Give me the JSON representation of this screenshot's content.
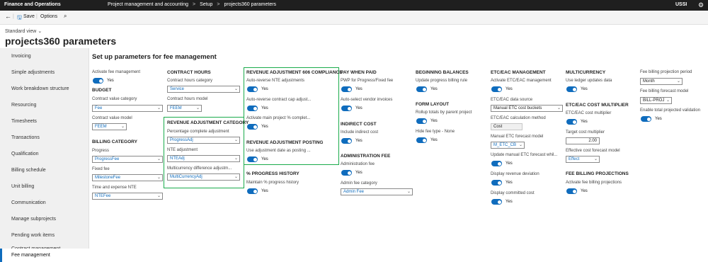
{
  "topbar": {
    "app_name": "Finance and Operations",
    "breadcrumb": [
      "Project management and accounting",
      "Setup",
      "projects360 parameters"
    ],
    "company": "USSI"
  },
  "actionbar": {
    "save_label": "Save",
    "options_label": "Options"
  },
  "header": {
    "view_name": "Standard view",
    "page_title": "projects360 parameters"
  },
  "sidebar": {
    "items": [
      "Invoicing",
      "Simple adjustments",
      "Work breakdown structure",
      "Resourcing",
      "Timesheets",
      "Transactions",
      "Qualification",
      "Billing schedule",
      "Unit billing",
      "Communication",
      "Manage subprojects",
      "Pending work items",
      "Contract management",
      "Fee management"
    ],
    "selected": "Fee management"
  },
  "content": {
    "section_title": "Set up parameters for fee management",
    "yes": "Yes",
    "col1": {
      "activate_label": "Activate fee management",
      "budget_header": "BUDGET",
      "cv_category_label": "Contract value category",
      "cv_category_value": "Fee",
      "cv_model_label": "Contract value model",
      "cv_model_value": "FEEM",
      "billing_header": "BILLING CATEGORY",
      "progress_label": "Progress",
      "progress_value": "ProgressFee",
      "fixed_label": "Fixed fee",
      "fixed_value": "MilestoneFee",
      "te_label": "Time and expense NTE",
      "te_value": "NTEFee"
    },
    "col2": {
      "hours_header": "CONTRACT HOURS",
      "hours_cat_label": "Contract hours category",
      "hours_cat_value": "Service",
      "hours_model_label": "Contract hours model",
      "hours_model_value": "FEEM",
      "rev_cat_header": "REVENUE ADJUSTMENT CATEGORY",
      "pct_label": "Percentage complete adjustment",
      "pct_value": "ProgressAdj",
      "nte_label": "NTE adjustment",
      "nte_value": "NTEAdj",
      "multi_label": "Multicurrency difference adjustm...",
      "multi_value": "MultiCurrencyAdj"
    },
    "col3": {
      "rev606_header": "REVENUE ADJUSTMENT 606 COMPLIANCE",
      "auto_nte_label": "Auto-reverse NTE adjustments",
      "auto_cap_label": "Auto-reverse contract cap adjust...",
      "main_pct_label": "Activate main project % complet...",
      "posting_header": "REVENUE ADJUSTMENT POSTING",
      "use_date_label": "Use adjustment date as posting ...",
      "history_header": "% PROGRESS HISTORY",
      "maintain_label": "Maintain % progress history"
    },
    "col4": {
      "pay_header": "PAY WHEN PAID",
      "pwp_label": "PWP for Progress/Fixed fee",
      "auto_vendor_label": "Auto-select vendor invoices",
      "indirect_header": "INDIRECT COST",
      "include_label": "Include indirect cost",
      "admin_header": "ADMINISTRATION FEE",
      "admin_label": "Administration fee",
      "admin_cat_label": "Admin fee category",
      "admin_cat_value": "Admin Fee"
    },
    "col5": {
      "beginning_header": "BEGINNING BALANCES",
      "update_label": "Update progress billing rule",
      "form_header": "FORM LAYOUT",
      "rollup_label": "Rollup totals by parent project",
      "hide_label": "Hide fee type - None"
    },
    "col6": {
      "etc_header": "ETC/EAC MANAGEMENT",
      "activate_etc_label": "Activate ETC/EAC management",
      "source_label": "ETC/EAC data source",
      "source_value": "Manual ETC cost buckets",
      "calc_label": "ETC/EAC calculation method",
      "calc_value": "Cost",
      "forecast_label": "Manual ETC forecast model",
      "forecast_value": "M_ETC_CB",
      "update_manual_label": "Update manual ETC forecast whil...",
      "deviation_label": "Display revenue deviation",
      "committed_label": "Display committed cost"
    },
    "col7": {
      "multicurrency_header": "MULTICURRENCY",
      "ledger_label": "Use ledger updates data",
      "cost_mult_header": "ETC/EAC COST MULTIPLIER",
      "cost_mult_label": "ETC/EAC cost multiplier",
      "target_label": "Target cost multiplier",
      "target_value": "2.00",
      "effective_label": "Effective cost forecast model",
      "effective_value": "Effect",
      "projections_header": "FEE BILLING PROJECTIONS",
      "activate_proj_label": "Activate fee billing projections"
    },
    "col8": {
      "period_label": "Fee billing projection period",
      "period_value": "Month",
      "forecast_model_label": "Fee billing forecast model",
      "forecast_model_value": "BILL-PROJ",
      "total_label": "Enable total projected validation"
    }
  }
}
